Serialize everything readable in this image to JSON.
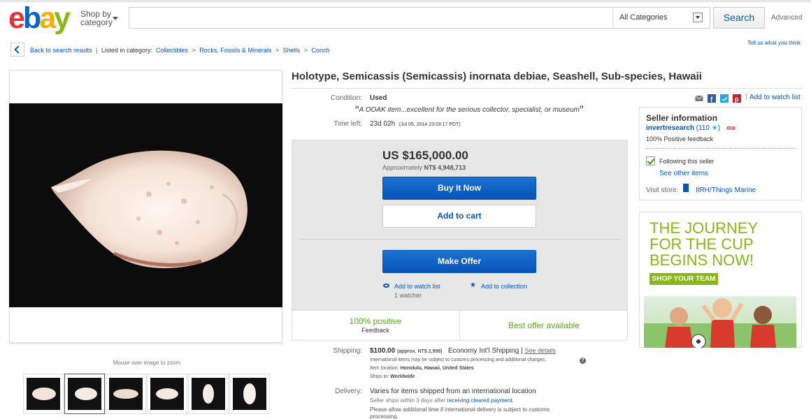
{
  "header": {
    "logo": {
      "e": "e",
      "b": "b",
      "a": "a",
      "y": "y"
    },
    "shop_by_line1": "Shop by",
    "shop_by_line2": "category",
    "search_value": "",
    "category_select": "All Categories",
    "search_button": "Search",
    "advanced_link": "Advanced"
  },
  "breadcrumb": {
    "back_label": "Back to search results",
    "listed_in": "Listed in category:",
    "categories": [
      "Collectibles",
      "Rocks, Fossils & Minerals",
      "Shells",
      "Conch"
    ],
    "separator": ">"
  },
  "tell_us": "Tell us what you think",
  "gallery": {
    "zoom_hint": "Mouse over image to zoom",
    "thumbnail_count": 6,
    "selected_index": 1
  },
  "item": {
    "title": "Holotype, Semicassis (Semicassis) inornata debiae, Seashell, Sub-species, Hawaii",
    "condition_label": "Condition:",
    "condition_value": "Used",
    "quote_open": "“",
    "quote": "A OOAK item...excellent for the serious collector, specialist, or museum",
    "quote_close": "”",
    "time_left_label": "Time left:",
    "time_left_value": "23d 02h",
    "time_left_end": "(Jul 05, 2014   23:03:17 PDT)"
  },
  "share": {
    "icons": [
      "email-icon",
      "facebook-icon",
      "twitter-icon",
      "pinterest-icon"
    ],
    "pipe": "|",
    "watch_label": "Add to watch list"
  },
  "buy": {
    "price": "US $165,000.00",
    "approx_label": "Approximately",
    "approx_value": "NT$ 4,948,713",
    "buy_now": "Buy It Now",
    "add_to_cart": "Add to cart",
    "make_offer": "Make Offer",
    "add_watch": "Add to watch list",
    "add_collection": "Add to collection",
    "watchers": "1 watcher",
    "positive": "100% positive",
    "feedback": "Feedback",
    "best_offer": "Best offer available"
  },
  "shipping": {
    "label": "Shipping:",
    "amount": "$100.00",
    "approx": "(approx. NT$ 2,999)",
    "service": "Economy Int'l Shipping",
    "pipe": "|",
    "see_details": "See details",
    "note_intl": "International items may be subject to customs processing and additional charges.",
    "location_label": "Item location:",
    "location_value": "Honolulu, Hawaii, United States",
    "ships_to_label": "Ships to:",
    "ships_to_value": "Worldwide",
    "help_icon": "?"
  },
  "delivery": {
    "label": "Delivery:",
    "value": "Varies for items shipped from an international location",
    "seller_ships": "Seller ships within 3 days after",
    "receiving": "receiving cleared payment.",
    "allow_time": "Please allow additional time if international delivery is subject to customs",
    "processing": "processing."
  },
  "seller": {
    "title": "Seller information",
    "name": "invertresearch",
    "count_open": "(110",
    "count_close": ")",
    "badge": "me",
    "positive": "100% Positive feedback",
    "following": "Following this seller",
    "see_other": "See other items",
    "visit_label": "Visit store:",
    "store": "IIRH/Things Marine"
  },
  "ad": {
    "line1": "THE JOURNEY",
    "line2": "FOR THE CUP",
    "line3": "BEGINS NOW!",
    "button": "SHOP YOUR TEAM"
  },
  "colors": {
    "link_blue": "#0654ba",
    "positive_green": "#5ba71b",
    "ad_green": "#86b817"
  }
}
